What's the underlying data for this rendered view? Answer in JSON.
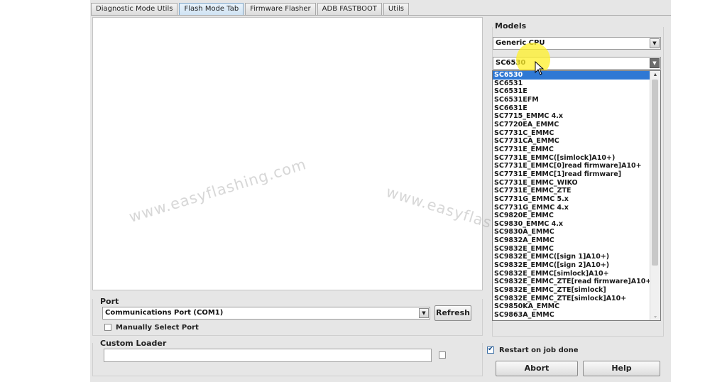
{
  "tabs": [
    {
      "label": "Diagnostic  Mode Utils"
    },
    {
      "label": "Flash Mode Tab"
    },
    {
      "label": "Firmware Flasher"
    },
    {
      "label": "ADB FASTBOOT"
    },
    {
      "label": "Utils"
    }
  ],
  "watermark": "www.easyflashing.com",
  "watermark_partial": "www.easyflas",
  "port": {
    "title": "Port",
    "selected": "Communications Port (COM1)",
    "refresh_label": "Refresh",
    "manual_label": "Manually Select Port",
    "manual_checked": false
  },
  "custom_loader": {
    "title": "Custom Loader",
    "value": "",
    "checked": false
  },
  "models": {
    "title": "Models",
    "cpu_selected": "Generic CPU",
    "model_selected": "SC6530",
    "options": [
      "SC6530",
      "SC6531",
      "SC6531E",
      "SC6531EFM",
      "SC6631E",
      "SC7715_EMMC 4.x",
      "SC7720EA_EMMC",
      "SC7731C_EMMC",
      "SC7731CA_EMMC",
      "SC7731E_EMMC",
      "SC7731E_EMMC([simlock]A10+)",
      "SC7731E_EMMC[0]read firmware]A10+",
      "SC7731E_EMMC[1]read firmware]",
      "SC7731E_EMMC_WIKO",
      "SC7731E_EMMC_ZTE",
      "SC7731G_EMMC  5.x",
      "SC7731G_EMMC 4.x",
      "SC9820E_EMMC",
      "SC9830_EMMC 4.x",
      "SC9830A_EMMC",
      "SC9832A_EMMC",
      "SC9832E_EMMC",
      "SC9832E_EMMC([sign 1]A10+)",
      "SC9832E_EMMC([sign 2]A10+)",
      "SC9832E_EMMC[simlock]A10+",
      "SC9832E_EMMC_ZTE[read firmware]A10+",
      "SC9832E_EMMC_ZTE[simlock]",
      "SC9832E_EMMC_ZTE[simlock]A10+",
      "SC9850KA_EMMC",
      "SC9863A_EMMC"
    ],
    "highlighted_index": 0
  },
  "restart": {
    "label": "Restart on job done",
    "checked": true
  },
  "abort_label": "Abort",
  "help_label": "Help",
  "icons": {
    "dropdown": "chevron-down-icon",
    "cursor": "mouse-pointer-icon"
  }
}
